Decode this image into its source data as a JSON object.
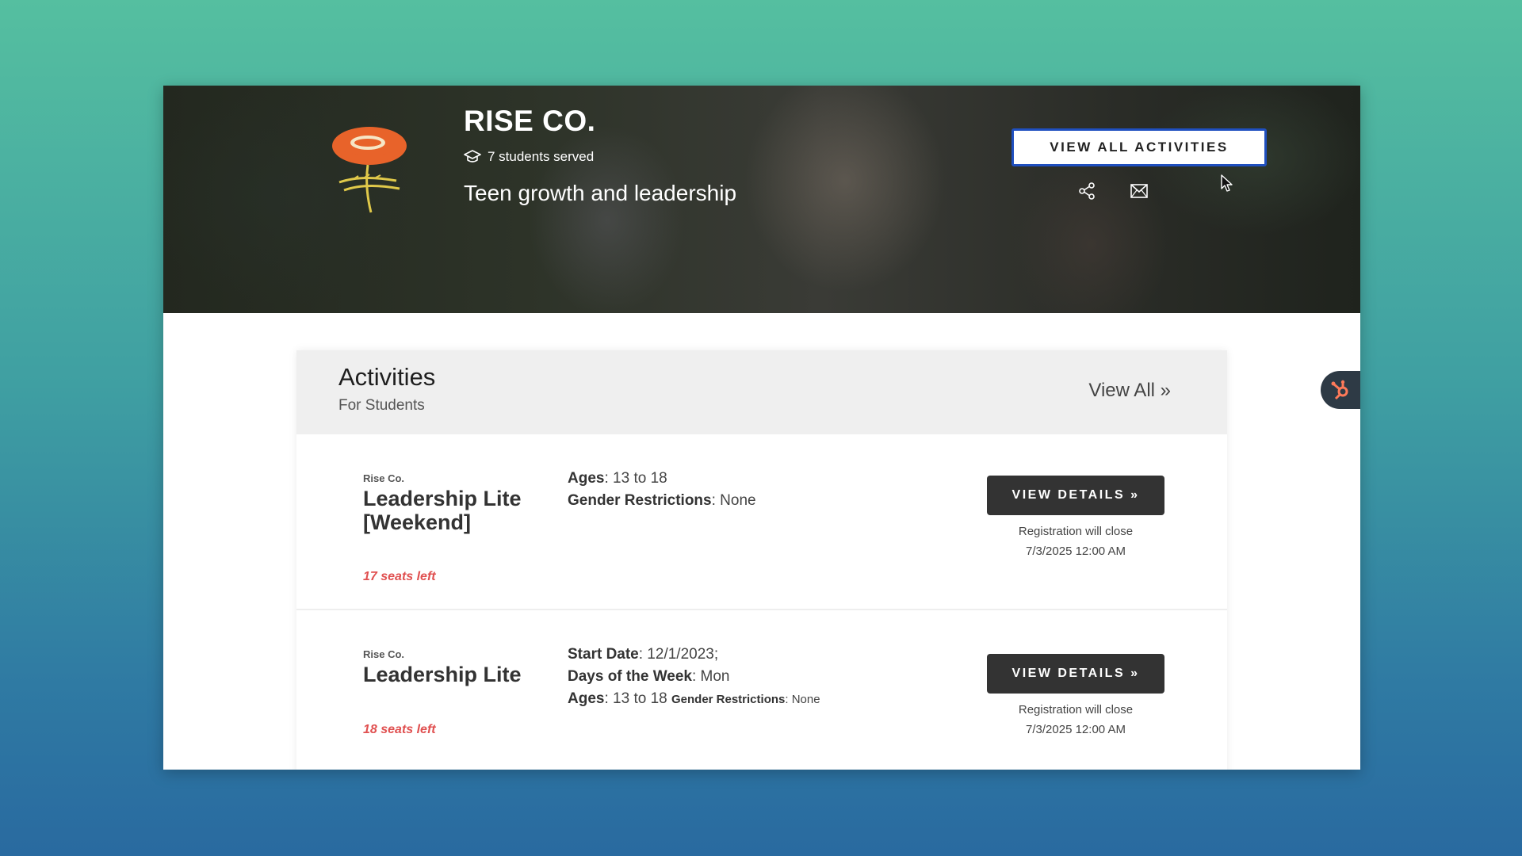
{
  "header": {
    "org_name": "RISE CO.",
    "students_served": "7 students served",
    "tagline": "Teen growth and leadership",
    "view_all_activities_label": "VIEW ALL ACTIVITIES",
    "icons": [
      "graduation-cap-icon",
      "share-icon",
      "mail-icon"
    ]
  },
  "activities_section": {
    "title": "Activities",
    "subtitle": "For Students",
    "view_all_label": "View All »"
  },
  "activities": [
    {
      "org": "Rise Co.",
      "name": "Leadership Lite [Weekend]",
      "seats": "17 seats left",
      "ages_label": "Ages",
      "ages_value": ": 13 to 18",
      "gender_label": "Gender Restrictions",
      "gender_value": ": None",
      "button_label": "VIEW DETAILS »",
      "reg_line1": "Registration will close",
      "reg_line2": "7/3/2025 12:00 AM"
    },
    {
      "org": "Rise Co.",
      "name": "Leadership Lite",
      "seats": "18 seats left",
      "start_label": "Start Date",
      "start_value": ": 12/1/2023;",
      "days_label": "Days of the Week",
      "days_value": ": Mon",
      "ages_label": "Ages",
      "ages_value": ": 13 to 18",
      "gender_label": "Gender Restrictions",
      "gender_value": ": None",
      "button_label": "VIEW DETAILS »",
      "reg_line1": "Registration will close",
      "reg_line2": "7/3/2025 12:00 AM"
    }
  ],
  "colors": {
    "accent_orange": "#e8632a",
    "seats_red": "#e05050",
    "button_dark": "#333333",
    "focus_blue": "#1f4fbf"
  }
}
